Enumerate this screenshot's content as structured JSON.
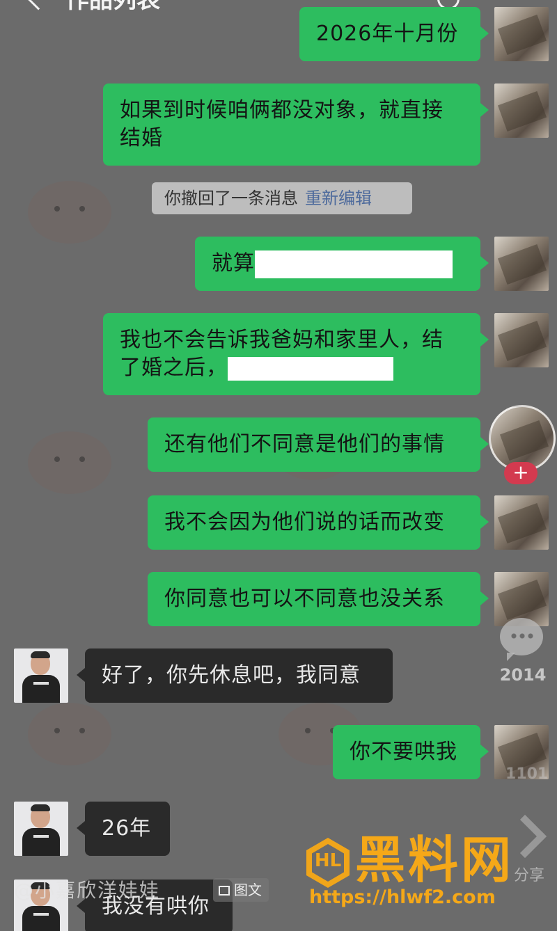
{
  "header": {
    "title": "作品列表"
  },
  "messages": [
    {
      "side": "mine",
      "text": "2026年十月份"
    },
    {
      "side": "mine",
      "text": "如果到时候咱俩都没对象，就直接结婚"
    },
    {
      "side": "mine",
      "text_before_redaction": "就算",
      "redacted": true
    },
    {
      "side": "mine",
      "text_before_redaction": "我也不会告诉我爸妈和家里人，结了婚之后，",
      "redacted": true
    },
    {
      "side": "mine",
      "text": "还有他们不同意是他们的事情"
    },
    {
      "side": "mine",
      "text": "我不会因为他们说的话而改变"
    },
    {
      "side": "mine",
      "text": "你同意也可以不同意也没关系"
    },
    {
      "side": "theirs",
      "text": "好了，你先休息吧，我同意"
    },
    {
      "side": "mine",
      "text": "你不要哄我"
    },
    {
      "side": "theirs",
      "text": "26年"
    },
    {
      "side": "theirs",
      "text": "我没有哄你"
    }
  ],
  "system_notice": {
    "text": "你撤回了一条消息",
    "action": "重新编辑"
  },
  "side_actions": {
    "follow_symbol": "+",
    "comment_count": "2014",
    "collect_count": "1101",
    "share_label": "分享"
  },
  "post": {
    "author": "@小嘉欣洋娃娃",
    "type_label": "图文"
  },
  "watermark": {
    "logo_text": "HL",
    "title": "黑料网",
    "url": "https://hlwf2.com"
  },
  "colors": {
    "mine_bubble": "#2dbd5f",
    "theirs_bubble": "#2a2a2a",
    "watermark": "#f5a818",
    "follow": "#d33a4f"
  }
}
